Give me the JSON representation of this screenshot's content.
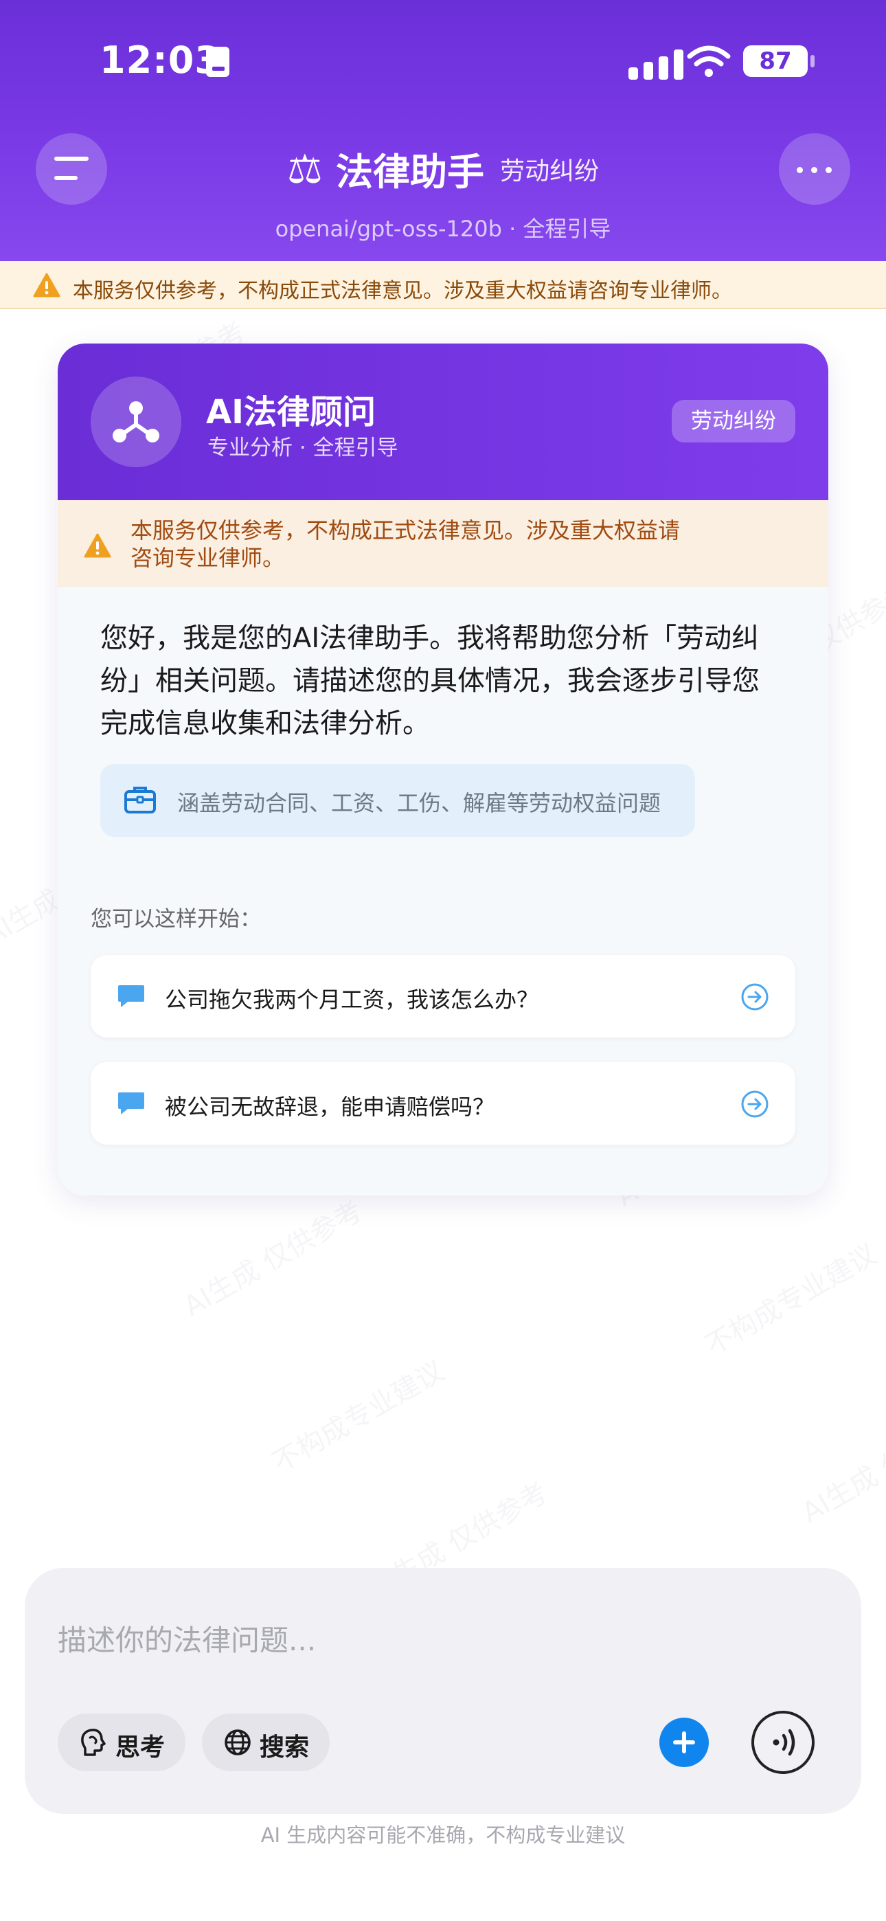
{
  "status_bar": {
    "time": "12:03",
    "battery": "87"
  },
  "header": {
    "title": "法律助手",
    "category": "劳动纠纷",
    "model_line": "openai/gpt-oss-120b · 全程引导"
  },
  "disclaimer_bar": {
    "text": "本服务仅供参考，不构成正式法律意见。涉及重大权益请咨询专业律师。"
  },
  "card": {
    "title": "AI法律顾问",
    "subtitle": "专业分析 · 全程引导",
    "badge": "劳动纠纷",
    "warning_line1": "本服务仅供参考，不构成正式法律意见。涉及重大权益请",
    "warning_line2": "咨询专业律师。",
    "greeting_line1": "您好，我是您的AI法律助手。我将帮助您分析「劳动纠",
    "greeting_line2": "纷」相关问题。请描述您的具体情况，我会逐步引导您",
    "greeting_line3": "完成信息收集和法律分析。",
    "scope": "涵盖劳动合同、工资、工伤、解雇等劳动权益问题",
    "start_label": "您可以这样开始：",
    "suggestions": [
      {
        "text": "公司拖欠我两个月工资，我该怎么办？"
      },
      {
        "text": "被公司无故辞退，能申请赔偿吗？"
      }
    ]
  },
  "watermark": {
    "a": "AI生成 仅供参考",
    "b": "不构成专业建议"
  },
  "composer": {
    "placeholder": "描述你的法律问题...",
    "think_label": "思考",
    "search_label": "搜索"
  },
  "footer": {
    "note": "AI 生成内容可能不准确，不构成专业建议"
  },
  "colors": {
    "brand": "#7336e0",
    "warning_text": "#a04b12",
    "warning_icon": "#f0a020",
    "accent_blue": "#1185ee"
  }
}
